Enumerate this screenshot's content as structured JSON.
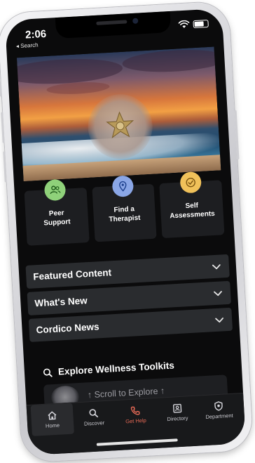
{
  "status_bar": {
    "time": "2:06",
    "back_label": "◂ Search"
  },
  "quick_actions": [
    {
      "label": "Peer\nSupport",
      "icon": "peer-support-icon",
      "color": "#8fd17a"
    },
    {
      "label": "Find a\nTherapist",
      "icon": "location-pin-icon",
      "color": "#8aa6e6"
    },
    {
      "label": "Self\nAssessments",
      "icon": "checkmark-icon",
      "color": "#f0c15a"
    }
  ],
  "accordion": [
    {
      "title": "Featured Content"
    },
    {
      "title": "What's New"
    },
    {
      "title": "Cordico News"
    }
  ],
  "explore": {
    "title": "Explore Wellness Toolkits",
    "scroll_text": "↑ Scroll to Explore ↑"
  },
  "tabs": [
    {
      "label": "Home",
      "icon": "home-icon"
    },
    {
      "label": "Discover",
      "icon": "search-icon"
    },
    {
      "label": "Get Help",
      "icon": "phone-icon"
    },
    {
      "label": "Directory",
      "icon": "directory-icon"
    },
    {
      "label": "Department",
      "icon": "badge-icon"
    }
  ],
  "colors": {
    "accent_gethelp": "#e86a56",
    "background": "#0b0b0c",
    "card": "#1d1e21"
  }
}
